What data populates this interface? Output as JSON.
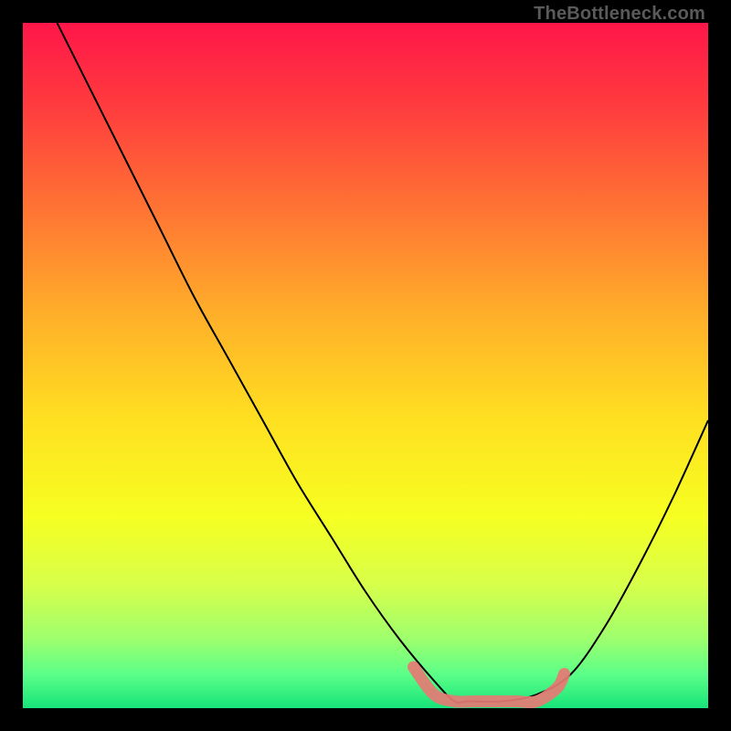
{
  "watermark": "TheBottleneck.com",
  "chart_data": {
    "type": "line",
    "title": "",
    "xlabel": "",
    "ylabel": "",
    "xlim": [
      0,
      100
    ],
    "ylim": [
      0,
      100
    ],
    "grid": false,
    "legend": false,
    "series": [
      {
        "name": "bottleneck-curve",
        "color": "#000000",
        "x": [
          5,
          10,
          15,
          20,
          25,
          30,
          35,
          40,
          45,
          50,
          55,
          60,
          63,
          65,
          70,
          75,
          80,
          85,
          90,
          95,
          100
        ],
        "values": [
          100,
          90,
          80,
          70,
          60,
          51,
          42,
          33,
          25,
          17,
          10,
          4,
          1,
          1,
          1,
          2,
          5,
          12,
          21,
          31,
          42
        ]
      },
      {
        "name": "valley-highlight",
        "color": "#e67a74",
        "x": [
          57,
          60,
          63,
          66,
          69,
          72,
          75,
          78,
          79
        ],
        "values": [
          6,
          2,
          1,
          1,
          1,
          1,
          1,
          3,
          5
        ]
      }
    ],
    "background_gradient": {
      "stops": [
        {
          "offset": 0.0,
          "color": "#ff1649"
        },
        {
          "offset": 0.12,
          "color": "#ff3b3e"
        },
        {
          "offset": 0.28,
          "color": "#ff7733"
        },
        {
          "offset": 0.42,
          "color": "#ffad2a"
        },
        {
          "offset": 0.58,
          "color": "#ffe021"
        },
        {
          "offset": 0.72,
          "color": "#f6ff21"
        },
        {
          "offset": 0.82,
          "color": "#d7ff4a"
        },
        {
          "offset": 0.9,
          "color": "#9dff6e"
        },
        {
          "offset": 0.95,
          "color": "#5cff88"
        },
        {
          "offset": 1.0,
          "color": "#17e47a"
        }
      ]
    }
  }
}
